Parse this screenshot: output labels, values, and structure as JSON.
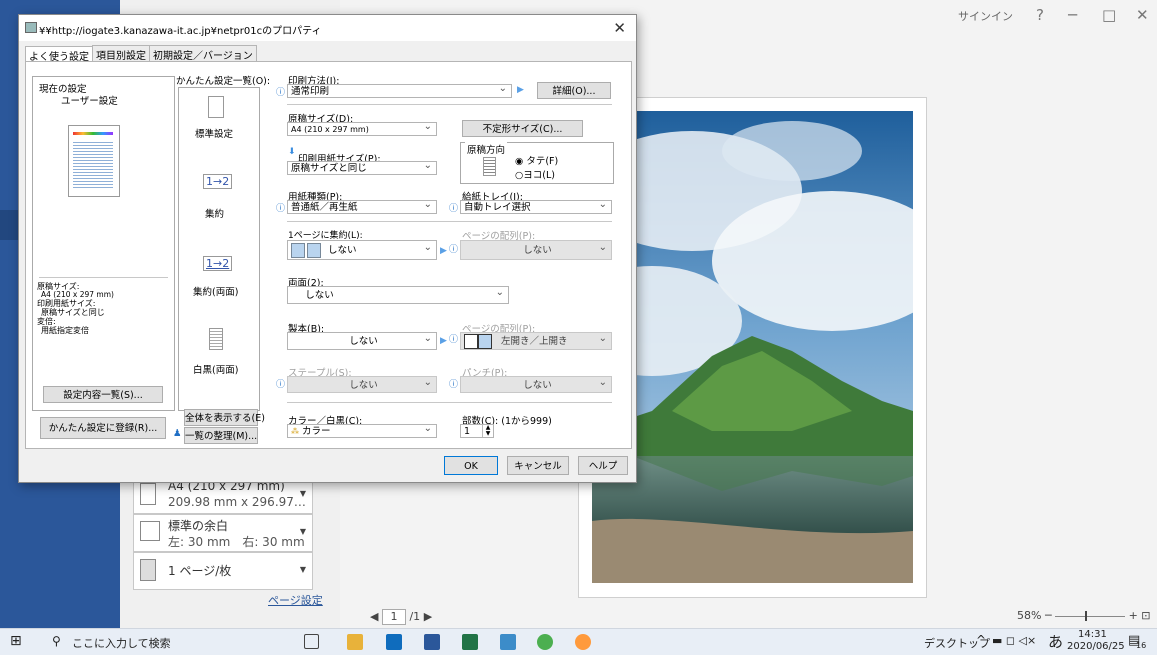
{
  "app": {
    "signin": "サインイン",
    "help": "?",
    "minimize": "─",
    "restore": "□",
    "close": "✕",
    "settings": [
      {
        "line1": "A4 (210 x 297 mm)",
        "line2": "209.98 mm x 296.97…"
      },
      {
        "line1": "標準の余白",
        "line2": "左: 30 mm　右: 30 mm"
      },
      {
        "line1": "1 ページ/枚",
        "line2": ""
      }
    ],
    "page_setup": "ページ設定",
    "page_current": "1",
    "page_total": "/1",
    "zoom": "58%"
  },
  "dialog": {
    "title": "¥¥http://iogate3.kanazawa-it.ac.jp¥netpr01cのプロパティ",
    "tabs": [
      "よく使う設定",
      "項目別設定",
      "初期設定／バージョン"
    ],
    "current_settings_label": "現在の設定",
    "current_settings_value": "ユーザー設定",
    "summary_lines": [
      "原稿サイズ:",
      "A4 (210 x 297 mm)",
      "印刷用紙サイズ:",
      "原稿サイズと同じ",
      "変倍:",
      "用紙指定変倍"
    ],
    "settings_list_button": "設定内容一覧(S)...",
    "register_button": "かんたん設定に登録(R)...",
    "quick_label": "かんたん設定一覧(O):",
    "quick_items": [
      "標準設定",
      "集約",
      "集約(両面)",
      "白黒(両面)"
    ],
    "show_all_button": "全体を表示する(E)",
    "organize_button": "一覧の整理(M)...",
    "print_method_label": "印刷方法(J):",
    "print_method_value": "通常印刷",
    "detail_button": "詳細(O)...",
    "paper_size_label": "原稿サイズ(D):",
    "paper_size_value": "A4 (210 x 297 mm)",
    "custom_size_button": "不定形サイズ(C)...",
    "orientation_label": "原稿方向",
    "orientation_portrait": "タテ(F)",
    "orientation_landscape": "ヨコ(L)",
    "print_paper_label": "印刷用紙サイズ(P):",
    "print_paper_value": "原稿サイズと同じ",
    "paper_type_label": "用紙種類(P):",
    "paper_type_value": "普通紙／再生紙",
    "tray_label": "給紙トレイ(I):",
    "tray_value": "自動トレイ選択",
    "nup_label": "1ページに集約(L):",
    "nup_value": "しない",
    "page_order_label": "ページの配列(P):",
    "page_order_value": "しない",
    "duplex_label": "両面(2):",
    "duplex_value": "しない",
    "booklet_label": "製本(B):",
    "booklet_value": "しない",
    "booklet_order_label": "ページの配列(P):",
    "booklet_order_value": "左開き／上開き",
    "staple_label": "ステープル(S):",
    "staple_value": "しない",
    "punch_label": "パンチ(P):",
    "punch_value": "しない",
    "color_label": "カラー／白黒(C):",
    "color_value": "カラー",
    "copies_label": "部数(C): (1から999)",
    "copies_value": "1",
    "ok": "OK",
    "cancel": "キャンセル",
    "help": "ヘルプ"
  },
  "taskbar": {
    "search_placeholder": "ここに入力して検索",
    "desktop": "デスクトップ",
    "ime": "あ",
    "time": "14:31",
    "date": "2020/06/25",
    "notifications": "16"
  },
  "colors": {
    "word_blue": "#2b579a",
    "accent": "#0078d7"
  }
}
